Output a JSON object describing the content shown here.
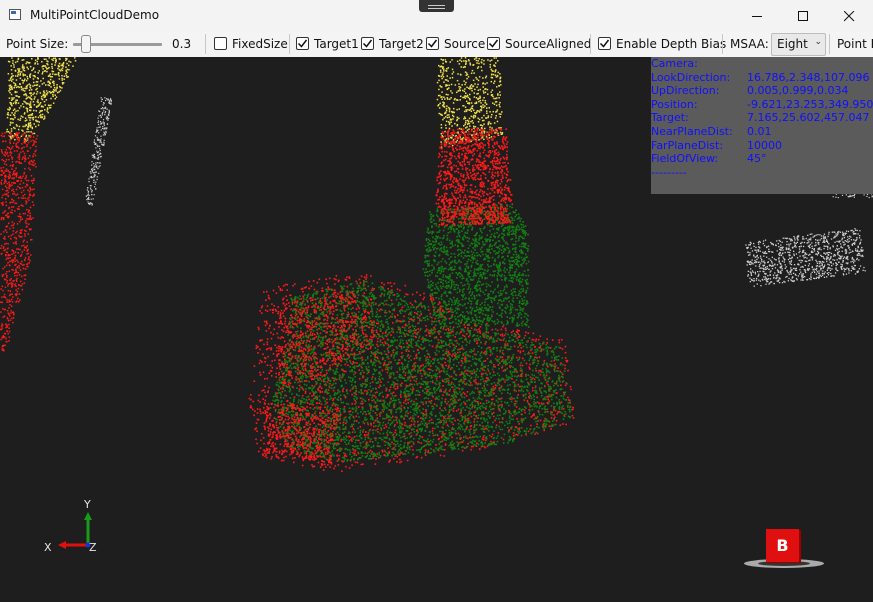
{
  "window": {
    "title": "MultiPointCloudDemo",
    "minimize_icon": "minimize-icon",
    "maximize_icon": "maximize-icon",
    "close_icon": "close-icon"
  },
  "toolbar": {
    "point_size_label": "Point Size:",
    "point_size_value": "0.3",
    "point_size_fraction": 0.1,
    "fixed_size_label": "FixedSize",
    "fixed_size_checked": false,
    "target1_label": "Target1",
    "target1_checked": true,
    "target2_label": "Target2",
    "target2_checked": true,
    "source_label": "Source",
    "source_checked": true,
    "source_aligned_label": "SourceAligned",
    "source_aligned_checked": true,
    "depth_bias_label": "Enable Depth Bias",
    "depth_bias_checked": true,
    "msaa_label": "MSAA:",
    "msaa_value": "Eight",
    "point_label": "Point R"
  },
  "camera_info": {
    "header": "Camera:",
    "rows": [
      {
        "key": "LookDirection:",
        "value": "16.786,2.348,107.096"
      },
      {
        "key": "UpDirection:",
        "value": "0.005,0.999,0.034"
      },
      {
        "key": "Position:",
        "value": "-9.621,23.253,349.950"
      },
      {
        "key": "Target:",
        "value": "7.165,25.602,457.047"
      },
      {
        "key": "NearPlaneDist:",
        "value": "0.01"
      },
      {
        "key": "FarPlaneDist:",
        "value": "10000"
      },
      {
        "key": "FieldOfView:",
        "value": "45°"
      }
    ],
    "footer": "---------"
  },
  "axes": {
    "x": "X",
    "y": "Y",
    "z": "Z"
  },
  "view_cube": {
    "face": "B"
  },
  "colors": {
    "background": "#1e1e1e",
    "info_text": "#1010ff",
    "target_red": "#ff1a1a",
    "source_green": "#128012",
    "yellow": "#f0e04a",
    "gray": "#cfcfcf"
  }
}
